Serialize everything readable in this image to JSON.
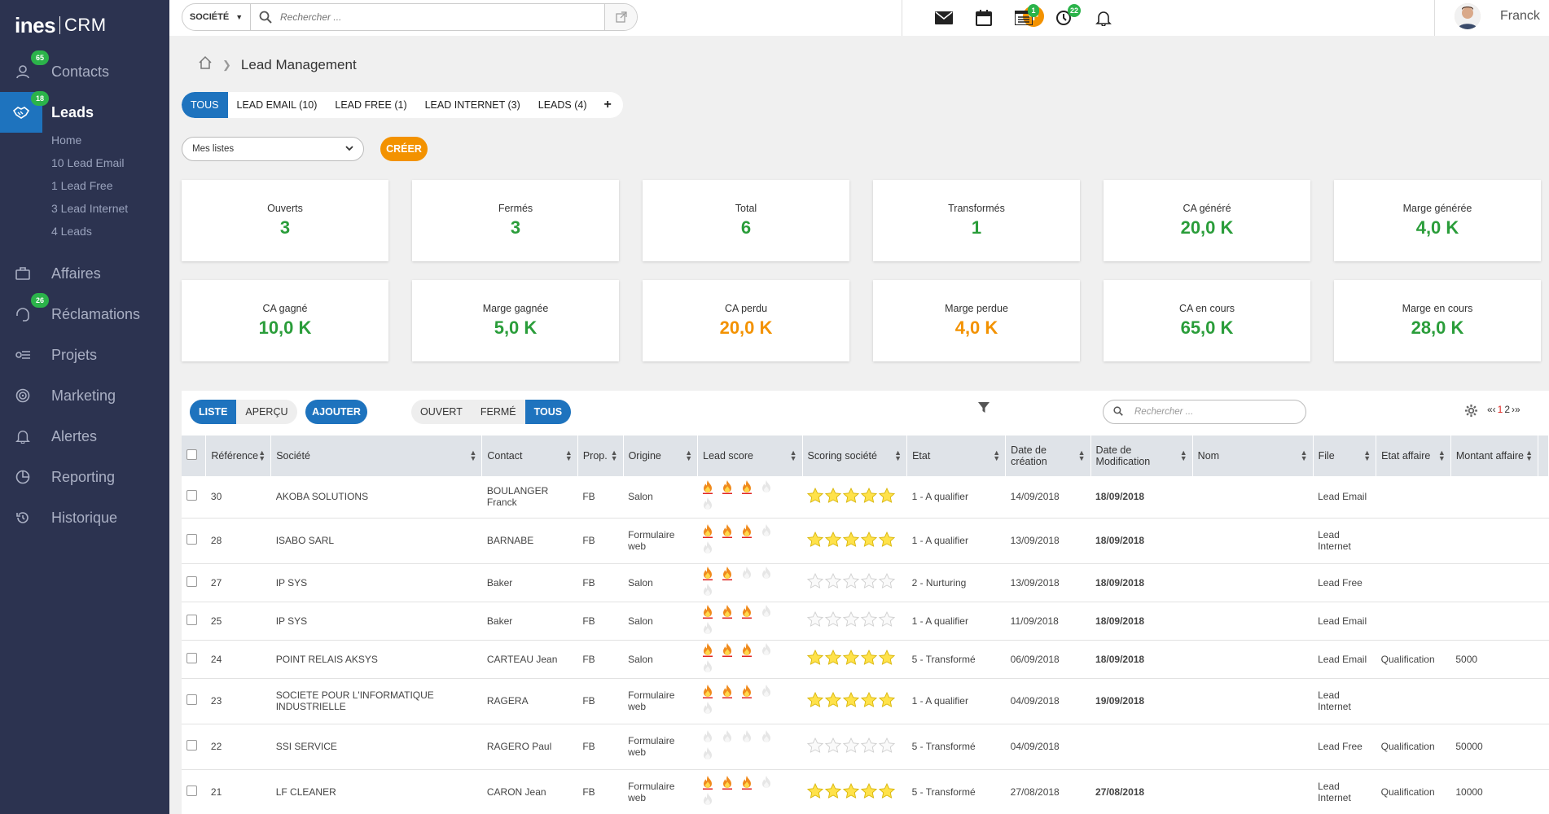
{
  "app": {
    "logo_main": "ines",
    "logo_sub": "CRM"
  },
  "sidebar": {
    "items": [
      {
        "label": "Contacts",
        "badge": "65",
        "icon": "user-icon"
      },
      {
        "label": "Leads",
        "badge": "18",
        "icon": "handshake-icon",
        "active": true
      },
      {
        "label": "Affaires",
        "badge": "",
        "icon": "briefcase-icon"
      },
      {
        "label": "Réclamations",
        "badge": "26",
        "icon": "headset-icon"
      },
      {
        "label": "Projets",
        "badge": "",
        "icon": "project-icon"
      },
      {
        "label": "Marketing",
        "badge": "",
        "icon": "target-icon"
      },
      {
        "label": "Alertes",
        "badge": "",
        "icon": "bell-icon"
      },
      {
        "label": "Reporting",
        "badge": "",
        "icon": "pie-chart-icon"
      },
      {
        "label": "Historique",
        "badge": "",
        "icon": "history-icon"
      }
    ],
    "leads_sub": [
      "Home",
      "10 Lead Email",
      "1 Lead Free",
      "3 Lead Internet",
      "4 Leads"
    ]
  },
  "topbar": {
    "search_scope": "SOCIÉTÉ",
    "search_placeholder": "Rechercher ...",
    "tasks_badge": "1",
    "clock_badge": "22",
    "user_name": "Franck"
  },
  "breadcrumb": {
    "page": "Lead Management"
  },
  "tabs": [
    "TOUS",
    "LEAD EMAIL (10)",
    "LEAD FREE (1)",
    "LEAD INTERNET (3)",
    "LEADS (4)",
    "+"
  ],
  "lists": {
    "select_value": "Mes listes",
    "create_label": "CRÉER"
  },
  "kpis": [
    {
      "label": "Ouverts",
      "value": "3",
      "color": "#2a9d3a"
    },
    {
      "label": "Fermés",
      "value": "3",
      "color": "#2a9d3a"
    },
    {
      "label": "Total",
      "value": "6",
      "color": "#2a9d3a"
    },
    {
      "label": "Transformés",
      "value": "1",
      "color": "#2a9d3a"
    },
    {
      "label": "CA généré",
      "value": "20,0 K",
      "color": "#2a9d3a"
    },
    {
      "label": "Marge générée",
      "value": "4,0 K",
      "color": "#2a9d3a"
    },
    {
      "label": "CA gagné",
      "value": "10,0 K",
      "color": "#2a9d3a"
    },
    {
      "label": "Marge gagnée",
      "value": "5,0 K",
      "color": "#2a9d3a"
    },
    {
      "label": "CA perdu",
      "value": "20,0 K",
      "color": "#f39200"
    },
    {
      "label": "Marge perdue",
      "value": "4,0 K",
      "color": "#f39200"
    },
    {
      "label": "CA en cours",
      "value": "65,0 K",
      "color": "#2a9d3a"
    },
    {
      "label": "Marge en cours",
      "value": "28,0 K",
      "color": "#2a9d3a"
    }
  ],
  "toolbar": {
    "view_list": "LISTE",
    "view_preview": "APERÇU",
    "add_label": "AJOUTER",
    "status_open": "OUVERT",
    "status_closed": "FERMÉ",
    "status_all": "TOUS",
    "search_placeholder": "Rechercher ...",
    "pager_prev": "«‹",
    "page_1": "1",
    "page_2": "2",
    "pager_next": "›»"
  },
  "table": {
    "headers": [
      "Référence",
      "Société",
      "Contact",
      "Prop.",
      "Origine",
      "Lead score",
      "Scoring société",
      "Etat",
      "Date de création",
      "Date de Modification",
      "Nom",
      "File",
      "Etat affaire",
      "Montant affaire"
    ],
    "rows": [
      {
        "ref": "30",
        "societe": "AKOBA SOLUTIONS",
        "contact": "BOULANGER Franck",
        "prop": "FB",
        "origine": "Salon",
        "lead": 3,
        "stars": 5,
        "etat": "1 - A qualifier",
        "creation": "14/09/2018",
        "modif": "18/09/2018",
        "modif_color": "green",
        "nom": "",
        "file": "Lead Email",
        "etat_affaire": "",
        "montant": ""
      },
      {
        "ref": "28",
        "societe": "ISABO SARL",
        "contact": "BARNABE",
        "prop": "FB",
        "origine": "Formulaire web",
        "lead": 3,
        "stars": 5,
        "etat": "1 - A qualifier",
        "creation": "13/09/2018",
        "modif": "18/09/2018",
        "modif_color": "green",
        "nom": "",
        "file": "Lead Internet",
        "etat_affaire": "",
        "montant": ""
      },
      {
        "ref": "27",
        "societe": "IP SYS",
        "contact": "Baker",
        "prop": "FB",
        "origine": "Salon",
        "lead": 2,
        "stars": 0,
        "etat": "2 - Nurturing",
        "creation": "13/09/2018",
        "modif": "18/09/2018",
        "modif_color": "green",
        "nom": "",
        "file": "Lead Free",
        "etat_affaire": "",
        "montant": ""
      },
      {
        "ref": "25",
        "societe": "IP SYS",
        "contact": "Baker",
        "prop": "FB",
        "origine": "Salon",
        "lead": 3,
        "stars": 0,
        "etat": "1 - A qualifier",
        "creation": "11/09/2018",
        "modif": "18/09/2018",
        "modif_color": "green",
        "nom": "",
        "file": "Lead Email",
        "etat_affaire": "",
        "montant": ""
      },
      {
        "ref": "24",
        "societe": "POINT RELAIS AKSYS",
        "contact": "CARTEAU Jean",
        "prop": "FB",
        "origine": "Salon",
        "lead": 3,
        "stars": 5,
        "etat": "5 - Transformé",
        "creation": "06/09/2018",
        "modif": "18/09/2018",
        "modif_color": "green",
        "nom": "",
        "file": "Lead Email",
        "etat_affaire": "Qualification",
        "montant": "5000"
      },
      {
        "ref": "23",
        "societe": "SOCIETE POUR L'INFORMATIQUE INDUSTRIELLE",
        "contact": "RAGERA",
        "prop": "FB",
        "origine": "Formulaire web",
        "lead": 3,
        "stars": 5,
        "etat": "1 - A qualifier",
        "creation": "04/09/2018",
        "modif": "19/09/2018",
        "modif_color": "green",
        "nom": "",
        "file": "Lead Internet",
        "etat_affaire": "",
        "montant": ""
      },
      {
        "ref": "22",
        "societe": "SSI SERVICE",
        "contact": "RAGERO Paul",
        "prop": "FB",
        "origine": "Formulaire web",
        "lead": 0,
        "stars": 0,
        "etat": "5 - Transformé",
        "creation": "04/09/2018",
        "modif": "",
        "modif_color": "",
        "nom": "",
        "file": "Lead Free",
        "etat_affaire": "Qualification",
        "montant": "50000"
      },
      {
        "ref": "21",
        "societe": "LF CLEANER",
        "contact": "CARON Jean",
        "prop": "FB",
        "origine": "Formulaire web",
        "lead": 3,
        "stars": 5,
        "etat": "5 - Transformé",
        "creation": "27/08/2018",
        "modif": "27/08/2018",
        "modif_color": "red",
        "nom": "",
        "file": "Lead Internet",
        "etat_affaire": "Qualification",
        "montant": "10000"
      }
    ]
  }
}
